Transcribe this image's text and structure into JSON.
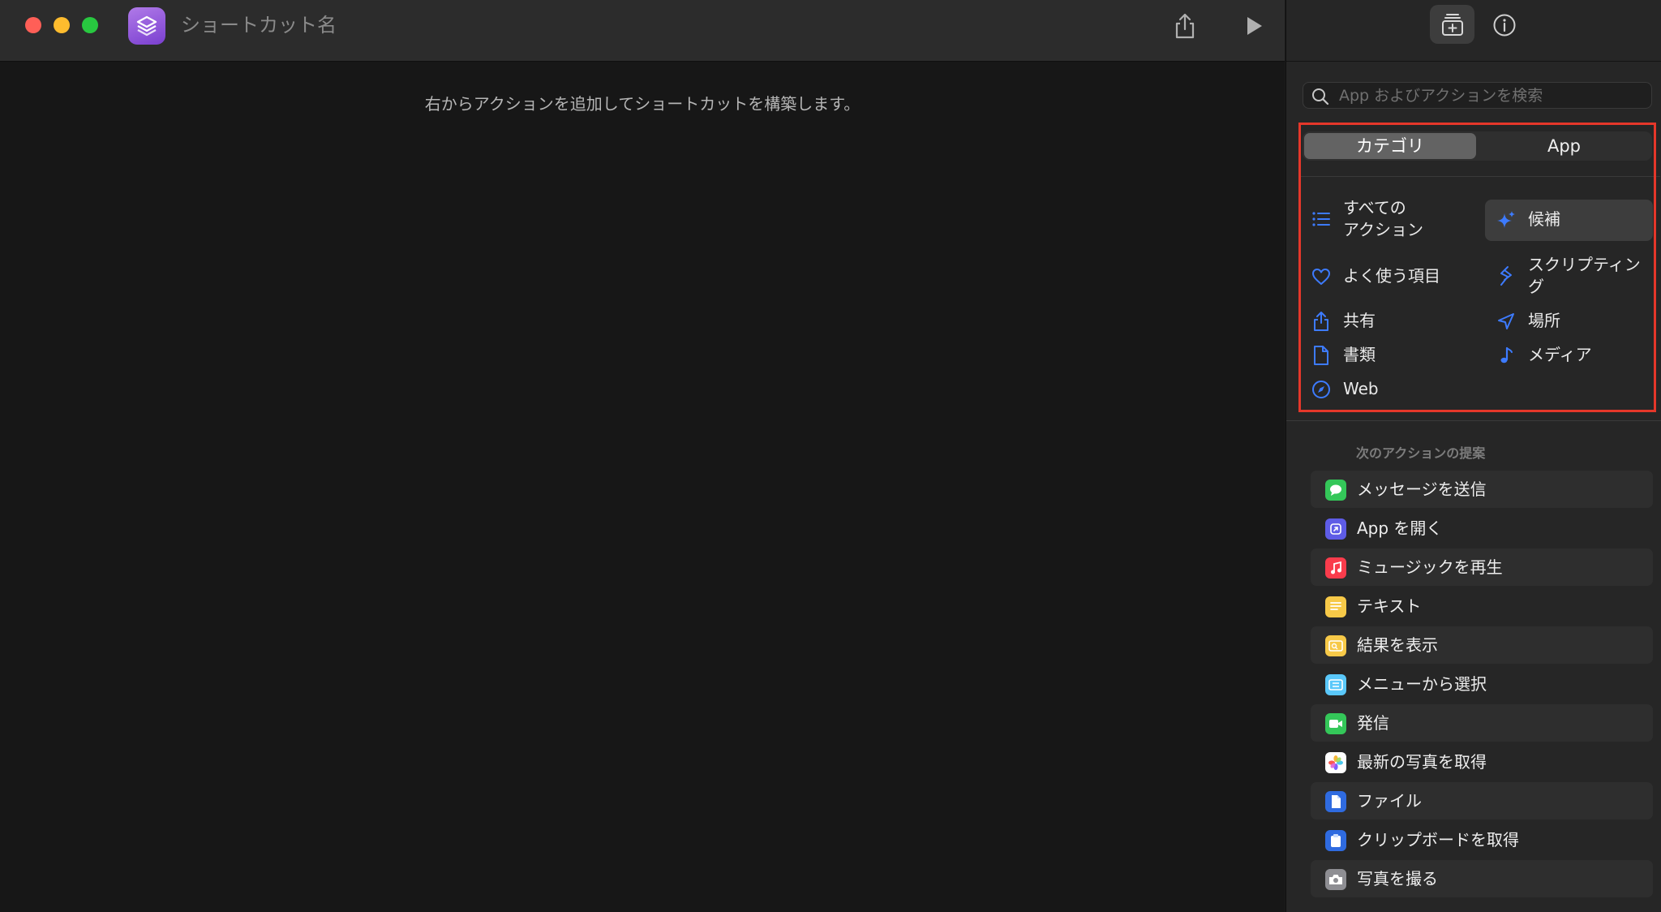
{
  "window": {
    "shortcut_name": "ショートカット名",
    "hint": "右からアクションを追加してショートカットを構築します。"
  },
  "sidebar": {
    "search_placeholder": "App およびアクションを検索",
    "segments": {
      "category": "カテゴリ",
      "app": "App",
      "selected": "category"
    },
    "categories": [
      {
        "label": "すべての\nアクション",
        "icon": "list-icon"
      },
      {
        "label": "候補",
        "icon": "sparkle-icon",
        "selected": true
      },
      {
        "label": "よく使う項目",
        "icon": "heart-icon"
      },
      {
        "label": "スクリプティン\nグ",
        "icon": "scripting-icon"
      },
      {
        "label": "共有",
        "icon": "share-icon"
      },
      {
        "label": "場所",
        "icon": "location-arrow-icon"
      },
      {
        "label": "書類",
        "icon": "document-icon"
      },
      {
        "label": "メディア",
        "icon": "music-note-icon"
      },
      {
        "label": "Web",
        "icon": "compass-icon"
      }
    ],
    "suggestions_title": "次のアクションの提案",
    "suggestions": [
      {
        "label": "メッセージを送信",
        "icon": "messages-icon",
        "color": "#34c759"
      },
      {
        "label": "App を開く",
        "icon": "open-app-icon",
        "color": "#5e5ce6"
      },
      {
        "label": "ミュージックを再生",
        "icon": "music-icon",
        "color": "#fa3c4c"
      },
      {
        "label": "テキスト",
        "icon": "text-icon",
        "color": "#f7c948"
      },
      {
        "label": "結果を表示",
        "icon": "show-result-icon",
        "color": "#f7c948"
      },
      {
        "label": "メニューから選択",
        "icon": "menu-icon",
        "color": "#5ac8fa"
      },
      {
        "label": "発信",
        "icon": "facetime-icon",
        "color": "#34c759"
      },
      {
        "label": "最新の写真を取得",
        "icon": "photos-icon",
        "color": "#ffffff"
      },
      {
        "label": "ファイル",
        "icon": "file-icon",
        "color": "#2f6be0"
      },
      {
        "label": "クリップボードを取得",
        "icon": "clipboard-icon",
        "color": "#2f6be0"
      },
      {
        "label": "写真を撮る",
        "icon": "camera-icon",
        "color": "#8e8e93"
      }
    ]
  },
  "colors": {
    "accent": "#3d7bff",
    "highlight_border": "#e5372a"
  }
}
